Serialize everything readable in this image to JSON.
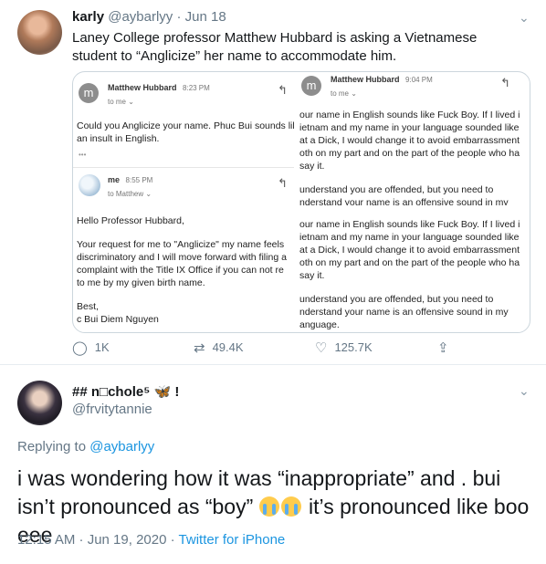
{
  "tweet1": {
    "name": "karly",
    "handle": "@aybarlyy",
    "date": "· Jun 18",
    "text": "Laney College professor Matthew Hubbard is asking a Vietnamese student to “Anglicize” her name to accommodate him.",
    "media": {
      "left": {
        "email1": {
          "avatar_letter": "m",
          "sender": "Matthew Hubbard",
          "time": "8:23 PM",
          "to": "to me ⌄",
          "body": [
            "Could you Anglicize your name. Phuc Bui sounds lil",
            "an insult in English."
          ],
          "ellipsis": "•••"
        },
        "email2": {
          "sender": "me",
          "time": "8:55 PM",
          "to": "to Matthew ⌄",
          "greeting": "Hello Professor Hubbard,",
          "body": [
            "Your request for me to \"Anglicize\" my name feels",
            "discriminatory and I will move forward with filing a",
            "complaint with the Title IX Office if you can not re",
            "to me by my given birth name."
          ],
          "signoff": "Best,",
          "signature": "c Bui Diem Nguyen"
        }
      },
      "right": {
        "avatar_letter": "m",
        "sender": "Matthew Hubbard",
        "time": "9:04 PM",
        "to": "to me ⌄",
        "block1": [
          "our name in English sounds like Fuck Boy. If I lived i",
          "ietnam and my name in your language sounded like",
          "at a Dick, I would change it to avoid embarrassment",
          "oth on my part and on the part of the people who ha",
          "say it."
        ],
        "block2": [
          "understand you are offended, but you need to",
          "nderstand your name is an offensive sound in my"
        ],
        "block3": [
          "our name in English sounds like Fuck Boy. If I lived i",
          "ietnam and my name in your language sounded like",
          "at a Dick, I would change it to avoid embarrassment",
          "oth on my part and on the part of the people who ha",
          "say it."
        ],
        "block4": [
          "understand you are offended, but you need to",
          "nderstand your name is an offensive sound in my",
          "anguage."
        ]
      }
    },
    "actions": {
      "replies": "1K",
      "retweets": "49.4K",
      "likes": "125.7K"
    }
  },
  "tweet2": {
    "name": "## n□chole⁵",
    "name_suffix": "!",
    "handle": "@frvitytannie",
    "replying_prefix": "Replying to",
    "replying_to": "@aybarlyy",
    "text_part1": "i was wondering how it was “inappropriate” and . bui isn’t pronounced as “boy”",
    "text_part2": "it’s pronounced like boo eee",
    "time": "12:15 AM · Jun 19, 2020 ·",
    "source": "Twitter for iPhone"
  },
  "icons": {
    "reply": "reply-icon",
    "retweet": "retweet-icon",
    "like": "heart-icon",
    "share": "share-icon",
    "chevron": "chevron-down-icon",
    "butterfly": "butterfly-emoji",
    "crying": "crying-emoji"
  },
  "colors": {
    "link": "#1b95e0",
    "muted": "#657786",
    "border": "#ccd6dd"
  }
}
